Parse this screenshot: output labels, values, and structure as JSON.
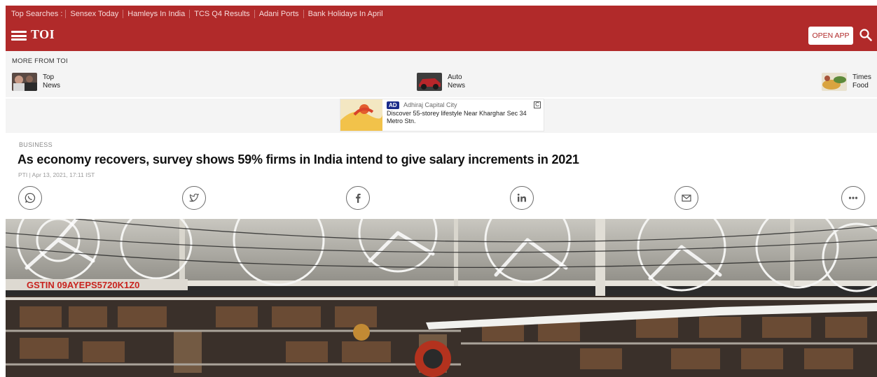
{
  "header": {
    "trending_lead": "Top Searches :",
    "trending": [
      "Sensex Today",
      "Hamleys In India",
      "TCS Q4 Results",
      "Adani Ports",
      "Bank Holidays In April"
    ],
    "logo": "TOI",
    "open_app": "OPEN APP",
    "menu_icon": "hamburger-icon",
    "search_icon": "search-icon",
    "brand_color": "#b12a2a"
  },
  "more_from": {
    "title": "MORE FROM TOI",
    "items": [
      {
        "line1": "Top",
        "line2": "News"
      },
      {
        "line1": "Auto",
        "line2": "News"
      },
      {
        "line1": "Times",
        "line2": "Food"
      }
    ]
  },
  "ad": {
    "badge": "AD",
    "source": "Adhiraj Capital City",
    "text": "Discover 55-storey lifestyle Near Kharghar Sec 34 Metro Stn.",
    "corner": "C"
  },
  "article": {
    "section": "BUSINESS",
    "headline": "As economy recovers, survey shows 59% firms in India intend to give salary increments in 2021",
    "byline": "PTI | Apr 13, 2021, 17:11 IST",
    "share_icons": [
      "whatsapp-icon",
      "twitter-icon",
      "facebook-icon",
      "linkedin-icon",
      "mail-icon",
      "more-icon"
    ],
    "hero_sign": "GSTIN 09AYEPS5720K1Z0"
  }
}
